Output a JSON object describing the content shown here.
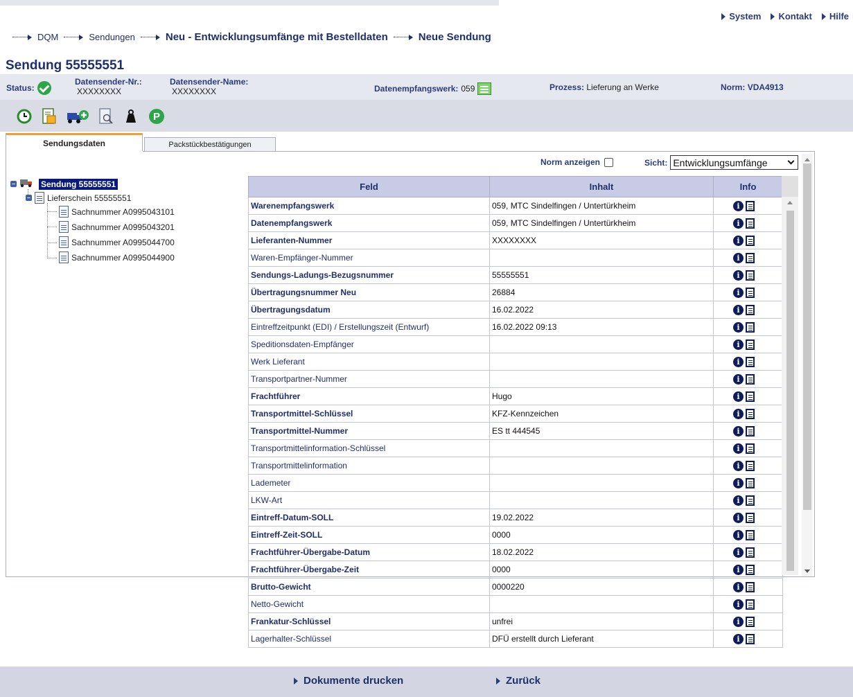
{
  "system_nav": [
    "System",
    "Kontakt",
    "Hilfe"
  ],
  "breadcrumb": [
    "DQM",
    "Sendungen",
    "Neu - Entwicklungsumfänge mit Bestelldaten",
    "Neue Sendung"
  ],
  "page_title": "Sendung 55555551",
  "status": {
    "status_label": "Status:",
    "datensender_nr_label": "Datensender-Nr.:",
    "datensender_nr": "XXXXXXXX",
    "datensender_name_label": "Datensender-Name:",
    "datensender_name": "XXXXXXXX",
    "datenempfangswerk_label": "Datenempfangswerk:",
    "datenempfangswerk": "059",
    "prozess_label": "Prozess:",
    "prozess": "Lieferung an Werke",
    "norm_label": "Norm:",
    "norm": "VDA4913"
  },
  "tabs": [
    "Sendungsdaten",
    "Packstückbestätigungen"
  ],
  "tree": {
    "root": "Sendung 55555551",
    "child": "Lieferschein 55555551",
    "items": [
      "Sachnummer A0995043101",
      "Sachnummer A0995043201",
      "Sachnummer A0995044700",
      "Sachnummer A0995044900"
    ]
  },
  "view": {
    "norm_anzeigen": "Norm anzeigen",
    "sicht_label": "Sicht:",
    "sicht_value": "Entwicklungsumfänge"
  },
  "table": {
    "headers": [
      "Feld",
      "Inhalt",
      "Info"
    ],
    "rows": [
      {
        "feld": "Warenempfangswerk",
        "inhalt": "059, MTC Sindelfingen / Untertürkheim",
        "bold": true
      },
      {
        "feld": "Datenempfangswerk",
        "inhalt": "059, MTC Sindelfingen / Untertürkheim",
        "bold": true
      },
      {
        "feld": "Lieferanten-Nummer",
        "inhalt": "XXXXXXXX",
        "bold": true
      },
      {
        "feld": "Waren-Empfänger-Nummer",
        "inhalt": "",
        "bold": false
      },
      {
        "feld": "Sendungs-Ladungs-Bezugsnummer",
        "inhalt": "55555551",
        "bold": true
      },
      {
        "feld": "Übertragungsnummer Neu",
        "inhalt": "26884",
        "bold": true
      },
      {
        "feld": "Übertragungsdatum",
        "inhalt": "16.02.2022",
        "bold": true
      },
      {
        "feld": "Eintreffzeitpunkt (EDI) / Erstellungszeit (Entwurf)",
        "inhalt": "16.02.2022 09:13",
        "bold": false
      },
      {
        "feld": "Speditionsdaten-Empfänger",
        "inhalt": "",
        "bold": false
      },
      {
        "feld": "Werk Lieferant",
        "inhalt": "",
        "bold": false
      },
      {
        "feld": "Transportpartner-Nummer",
        "inhalt": "",
        "bold": false
      },
      {
        "feld": "Frachtführer",
        "inhalt": "Hugo",
        "bold": true
      },
      {
        "feld": "Transportmittel-Schlüssel",
        "inhalt": "KFZ-Kennzeichen",
        "bold": true
      },
      {
        "feld": "Transportmittel-Nummer",
        "inhalt": "ES tt 444545",
        "bold": true
      },
      {
        "feld": "Transportmittelinformation-Schlüssel",
        "inhalt": "",
        "bold": false
      },
      {
        "feld": "Transportmittelinformation",
        "inhalt": "",
        "bold": false
      },
      {
        "feld": "Lademeter",
        "inhalt": "",
        "bold": false
      },
      {
        "feld": "LKW-Art",
        "inhalt": "",
        "bold": false
      },
      {
        "feld": "Eintreff-Datum-SOLL",
        "inhalt": "19.02.2022",
        "bold": true
      },
      {
        "feld": "Eintreff-Zeit-SOLL",
        "inhalt": "0000",
        "bold": true
      },
      {
        "feld": "Frachtführer-Übergabe-Datum",
        "inhalt": "18.02.2022",
        "bold": true
      },
      {
        "feld": "Frachtführer-Übergabe-Zeit",
        "inhalt": "0000",
        "bold": true
      },
      {
        "feld": "Brutto-Gewicht",
        "inhalt": "0000220",
        "bold": true
      },
      {
        "feld": "Netto-Gewicht",
        "inhalt": "",
        "bold": false
      },
      {
        "feld": "Frankatur-Schlüssel",
        "inhalt": "unfrei",
        "bold": true
      },
      {
        "feld": "Lagerhalter-Schlüssel",
        "inhalt": "DFÜ erstellt durch Lieferant",
        "bold": false
      }
    ]
  },
  "footer": [
    "Dokumente drucken",
    "Zurück"
  ],
  "colors": {
    "accent": "#1c2f6e",
    "header_bg": "#c7cbe6",
    "band": "#e6e8f0",
    "ok": "#2da64a"
  }
}
